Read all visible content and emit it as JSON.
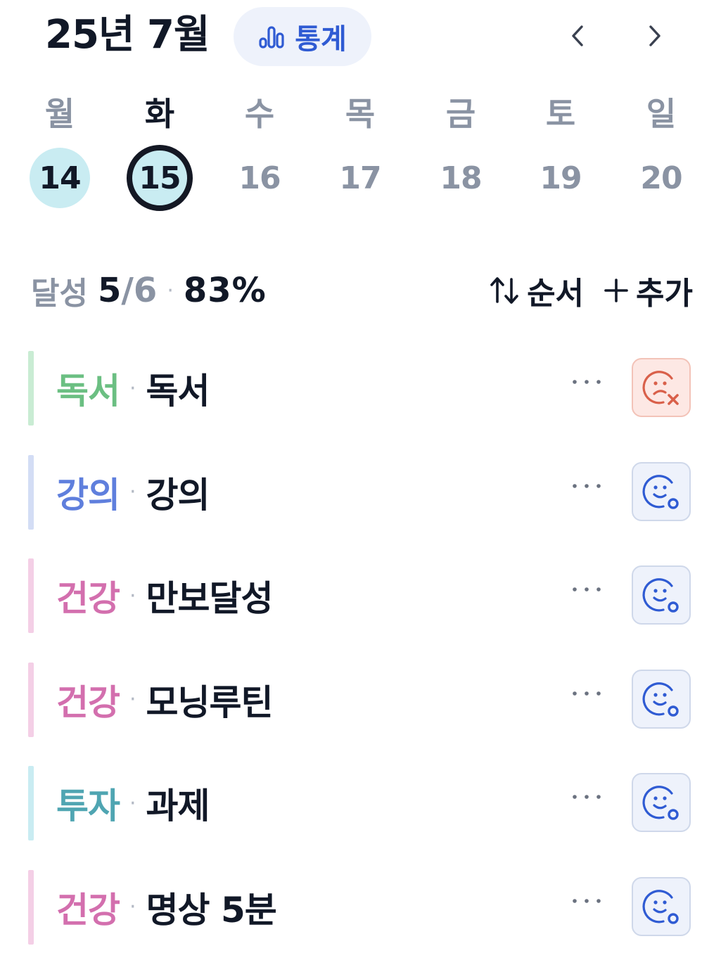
{
  "header": {
    "title": "25년 7월",
    "stats_label": "통계",
    "stats_icon": "bar-chart-icon",
    "prev_icon": "chevron-left-icon",
    "next_icon": "chevron-right-icon"
  },
  "week": {
    "days": [
      {
        "weekday": "월",
        "date": "14",
        "state": "done"
      },
      {
        "weekday": "화",
        "date": "15",
        "state": "today"
      },
      {
        "weekday": "수",
        "date": "16",
        "state": "none"
      },
      {
        "weekday": "목",
        "date": "17",
        "state": "none"
      },
      {
        "weekday": "금",
        "date": "18",
        "state": "none"
      },
      {
        "weekday": "토",
        "date": "19",
        "state": "none"
      },
      {
        "weekday": "일",
        "date": "20",
        "state": "none"
      }
    ]
  },
  "summary": {
    "label": "달성",
    "done": "5",
    "total": "/6",
    "separator": "·",
    "percent": "83%"
  },
  "actions": {
    "sort_label": "순서",
    "sort_icon": "sort-arrows-icon",
    "add_label": "추가",
    "add_icon": "plus-icon"
  },
  "habits": [
    {
      "category": "독서",
      "separator": "·",
      "title": "독서",
      "color": "#6bbf82",
      "bar_color": "#c9ecd3",
      "status": "fail"
    },
    {
      "category": "강의",
      "separator": "·",
      "title": "강의",
      "color": "#5f7fdd",
      "bar_color": "#d3ddf5",
      "status": "pending"
    },
    {
      "category": "건강",
      "separator": "·",
      "title": "만보달성",
      "color": "#d36fae",
      "bar_color": "#f4cfe6",
      "status": "pending"
    },
    {
      "category": "건강",
      "separator": "·",
      "title": "모닝루틴",
      "color": "#d36fae",
      "bar_color": "#f4cfe6",
      "status": "pending"
    },
    {
      "category": "투자",
      "separator": "·",
      "title": "과제",
      "color": "#4fa5b2",
      "bar_color": "#c9ecf2",
      "status": "pending"
    },
    {
      "category": "건강",
      "separator": "·",
      "title": "명상 5분",
      "color": "#d36fae",
      "bar_color": "#f4cfe6",
      "status": "pending"
    }
  ],
  "colors": {
    "accent": "#2f5bd3",
    "fail": "#d9604a",
    "today_ring": "#141824",
    "done_fill": "#c9ecf2"
  }
}
